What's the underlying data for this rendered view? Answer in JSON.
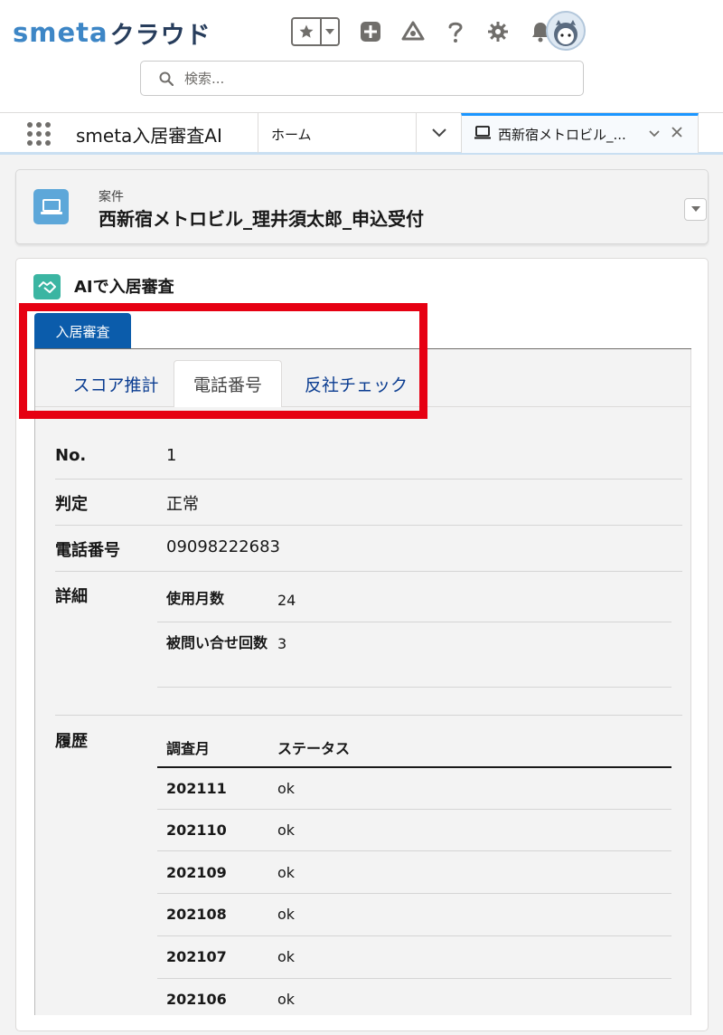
{
  "header": {
    "logo_a": "smeta",
    "logo_b": "クラウド",
    "search_placeholder": "検索..."
  },
  "nav": {
    "app_name": "smeta入居審査AI",
    "home": "ホーム",
    "record_tab": "西新宿メトロビル_..."
  },
  "record": {
    "type": "案件",
    "title": "西新宿メトロビル_理井須太郎_申込受付"
  },
  "card": {
    "title": "AIで入居審査",
    "outer_tab": "入居審査",
    "subtabs": [
      "スコア推計",
      "電話番号",
      "反社チェック"
    ],
    "active_subtab": "電話番号"
  },
  "details": {
    "no_label": "No.",
    "no_value": "1",
    "judgement_label": "判定",
    "judgement_value": "正常",
    "phone_label": "電話番号",
    "phone_value": "09098222683",
    "detail_label": "詳細",
    "detail_rows": [
      {
        "label": "使用月数",
        "value": "24"
      },
      {
        "label": "被問い合せ回数",
        "value": "3"
      }
    ],
    "history_label": "履歴",
    "history_columns": [
      "調査月",
      "ステータス"
    ],
    "history_rows": [
      {
        "month": "202111",
        "status": "ok"
      },
      {
        "month": "202110",
        "status": "ok"
      },
      {
        "month": "202109",
        "status": "ok"
      },
      {
        "month": "202108",
        "status": "ok"
      },
      {
        "month": "202107",
        "status": "ok"
      },
      {
        "month": "202106",
        "status": "ok"
      }
    ]
  },
  "colors": {
    "brand_blue": "#3d86c6",
    "tab_active": "#0b5cab",
    "highlight": "#e60012"
  },
  "icons": [
    "favorites-star-icon",
    "add-icon",
    "trailhead-icon",
    "help-icon",
    "setup-gear-icon",
    "notification-bell-icon",
    "search-icon",
    "app-launcher-icon",
    "record-icon",
    "handshake-icon"
  ]
}
